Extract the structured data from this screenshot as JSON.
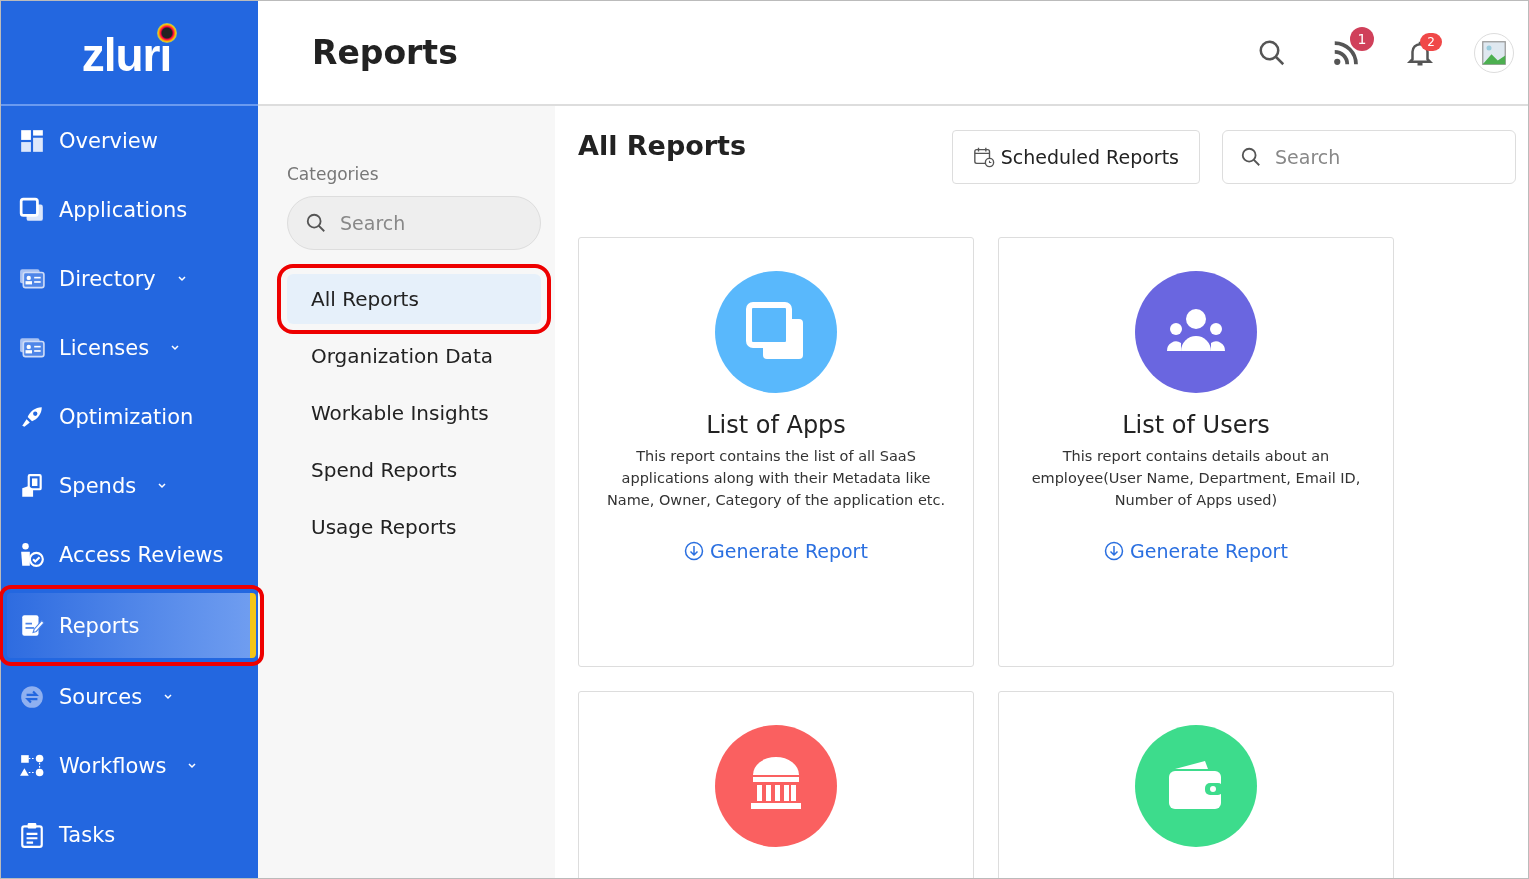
{
  "logo": {
    "text": "zluri"
  },
  "sidebar": {
    "items": [
      {
        "label": "Overview",
        "kind": "overview",
        "expandable": false,
        "selected": false,
        "highlighted": false
      },
      {
        "label": "Applications",
        "kind": "apps",
        "expandable": false,
        "selected": false,
        "highlighted": false
      },
      {
        "label": "Directory",
        "kind": "card",
        "expandable": true,
        "selected": false,
        "highlighted": false
      },
      {
        "label": "Licenses",
        "kind": "card",
        "expandable": true,
        "selected": false,
        "highlighted": false
      },
      {
        "label": "Optimization",
        "kind": "rocket",
        "expandable": false,
        "selected": false,
        "highlighted": false
      },
      {
        "label": "Spends",
        "kind": "spend",
        "expandable": true,
        "selected": false,
        "highlighted": false
      },
      {
        "label": "Access Reviews",
        "kind": "review",
        "expandable": false,
        "selected": false,
        "highlighted": false
      },
      {
        "label": "Reports",
        "kind": "report",
        "expandable": false,
        "selected": true,
        "highlighted": true
      },
      {
        "label": "Sources",
        "kind": "sources",
        "expandable": true,
        "selected": false,
        "highlighted": false
      },
      {
        "label": "Workflows",
        "kind": "workflow",
        "expandable": true,
        "selected": false,
        "highlighted": false
      },
      {
        "label": "Tasks",
        "kind": "tasks",
        "expandable": false,
        "selected": false,
        "highlighted": false
      }
    ]
  },
  "header": {
    "title": "Reports",
    "feed_badge": "1",
    "notification_badge": "2"
  },
  "categories": {
    "heading": "Categories",
    "search": {
      "placeholder": "Search"
    },
    "items": [
      {
        "label": "All Reports",
        "selected": true,
        "highlighted": true
      },
      {
        "label": "Organization Data",
        "selected": false,
        "highlighted": false
      },
      {
        "label": "Workable Insights",
        "selected": false,
        "highlighted": false
      },
      {
        "label": "Spend Reports",
        "selected": false,
        "highlighted": false
      },
      {
        "label": "Usage Reports",
        "selected": false,
        "highlighted": false
      }
    ]
  },
  "main": {
    "title": "All Reports",
    "scheduled_button": "Scheduled Reports",
    "search": {
      "placeholder": "Search"
    },
    "cards": [
      {
        "kind": "apps",
        "color": "#59b8fc",
        "title": "List of Apps",
        "description": "This report contains the list of all SaaS applications along with their Metadata like Name, Owner, Category of the application etc.",
        "action": "Generate Report"
      },
      {
        "kind": "users",
        "color": "#6a66e0",
        "title": "List of Users",
        "description": "This report contains details about an employee(User Name, Department, Email ID, Number of Apps used)",
        "action": "Generate Report"
      },
      {
        "kind": "bank",
        "color": "#fa6060"
      },
      {
        "kind": "wallet",
        "color": "#3ddc8c"
      }
    ]
  }
}
